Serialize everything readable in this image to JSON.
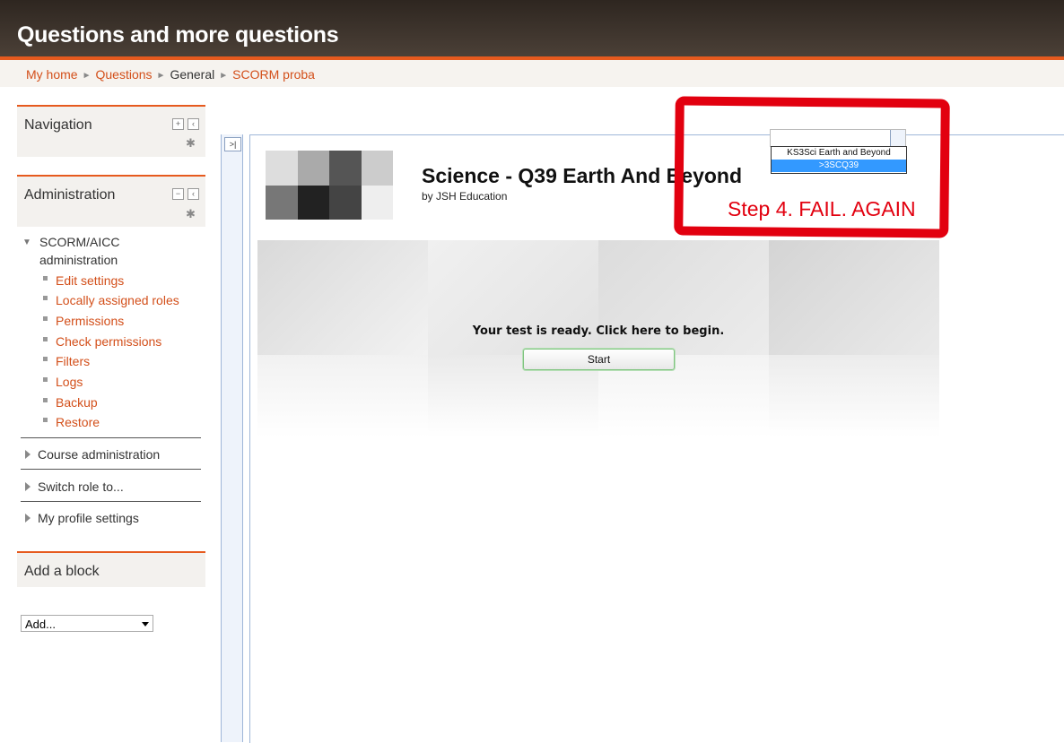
{
  "site": {
    "title": "Questions and more questions"
  },
  "breadcrumb": {
    "items": [
      {
        "label": "My home",
        "link": true
      },
      {
        "label": "Questions",
        "link": true
      },
      {
        "label": "General",
        "link": false
      },
      {
        "label": "SCORM proba",
        "link": true
      }
    ]
  },
  "navigation_block": {
    "title": "Navigation"
  },
  "admin_block": {
    "title": "Administration",
    "tree_root": [
      "SCORM/AICC",
      "administration"
    ],
    "items": [
      "Edit settings",
      "Locally assigned roles",
      "Permissions",
      "Check permissions",
      "Filters",
      "Logs",
      "Backup",
      "Restore"
    ],
    "sections": [
      "Course administration",
      "Switch role to...",
      "My profile settings"
    ]
  },
  "add_block": {
    "title": "Add a block",
    "select_value": "Add..."
  },
  "player": {
    "toggle_label": ">|",
    "sco_title": "Science - Q39 Earth And Beyond",
    "sco_byline": "by JSH Education",
    "ready_text": "Your test is ready. Click here to begin.",
    "start_label": "Start",
    "sco_options": [
      "KS3Sci Earth and Beyond",
      ">3SCQ39"
    ]
  },
  "annotation": {
    "text": "Step 4. FAIL. AGAIN",
    "color": "#e2000f"
  },
  "colors": {
    "accent": "#e65a1e",
    "link": "#d34f1a",
    "header_bg": "#3a312a",
    "highlight": "#3399ff"
  }
}
